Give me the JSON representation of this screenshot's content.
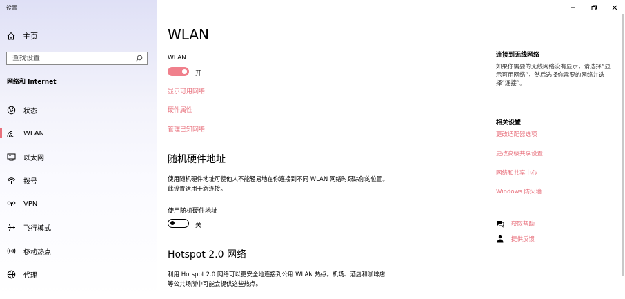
{
  "app": {
    "title": "设置"
  },
  "sidebar": {
    "home": "主页",
    "search_placeholder": "查找设置",
    "section": "网络和 Internet",
    "items": [
      {
        "label": "状态",
        "icon": "globe-status-icon"
      },
      {
        "label": "WLAN",
        "icon": "wifi-icon",
        "active": true
      },
      {
        "label": "以太网",
        "icon": "ethernet-icon"
      },
      {
        "label": "拨号",
        "icon": "dialup-icon"
      },
      {
        "label": "VPN",
        "icon": "vpn-icon"
      },
      {
        "label": "飞行模式",
        "icon": "airplane-icon"
      },
      {
        "label": "移动热点",
        "icon": "hotspot-icon"
      },
      {
        "label": "代理",
        "icon": "proxy-globe-icon"
      }
    ]
  },
  "main": {
    "title": "WLAN",
    "wlan_label": "WLAN",
    "wlan_state": "开",
    "links": [
      "显示可用网络",
      "硬件属性",
      "管理已知网络"
    ],
    "random_hw": {
      "heading": "随机硬件地址",
      "description": "使用随机硬件地址可使他人不能轻易地在你连接到不同 WLAN 网络时跟踪你的位置。此设置适用于新连接。",
      "toggle_label": "使用随机硬件地址",
      "state": "关"
    },
    "hotspot": {
      "heading": "Hotspot 2.0 网络",
      "description": "利用 Hotspot 2.0 网络可以更安全地连接到公用 WLAN 热点。机场、酒店和咖啡店等公共场所中可能会提供这些热点。"
    }
  },
  "right": {
    "connect_title": "连接到无线网络",
    "connect_text": "如果你需要的无线网络没有显示，请选择“显示可用网络”，然后选择你需要的网络并选择“连接”。",
    "related_title": "相关设置",
    "related_links": [
      "更改适配器选项",
      "更改高级共享设置",
      "网络和共享中心",
      "Windows 防火墙"
    ],
    "help": "获取帮助",
    "feedback": "提供反馈"
  },
  "colors": {
    "accent": "#e8707c"
  }
}
